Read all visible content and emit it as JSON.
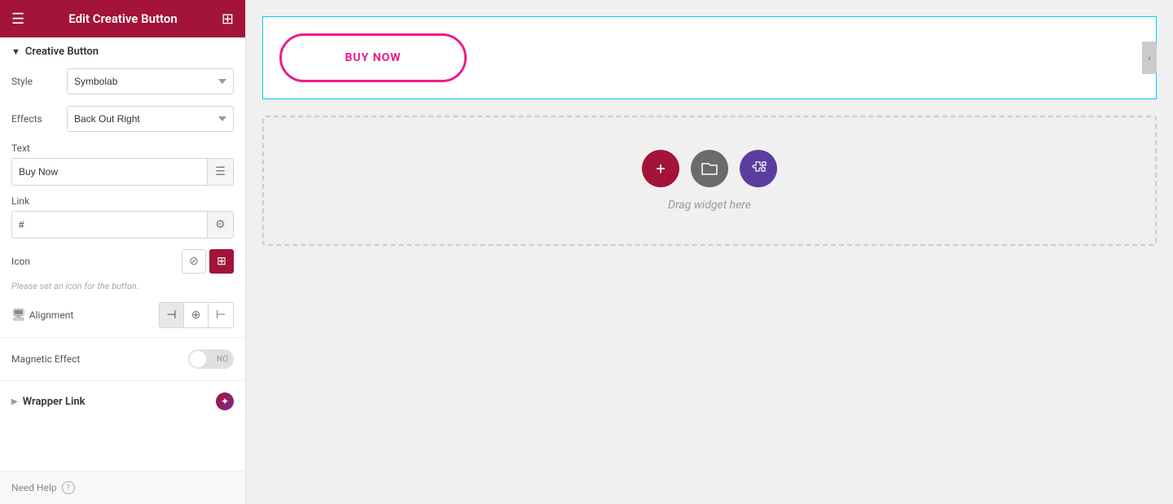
{
  "header": {
    "title": "Edit Creative Button",
    "menu_icon": "☰",
    "grid_icon": "⊞"
  },
  "sidebar": {
    "section_label": "Creative Button",
    "fields": {
      "style_label": "Style",
      "style_value": "Symbolab",
      "effects_label": "Effects",
      "effects_value": "Back Out Right",
      "text_label": "Text",
      "text_value": "Buy Now",
      "text_placeholder": "Buy Now",
      "link_label": "Link",
      "link_value": "#",
      "icon_label": "Icon",
      "icon_hint": "Please set an icon for the button.",
      "alignment_label": "Alignment",
      "magnetic_label": "Magnetic Effect",
      "toggle_no": "NO"
    },
    "wrapper_link": {
      "label": "Wrapper Link"
    },
    "footer": {
      "need_help": "Need Help",
      "help_symbol": "?"
    }
  },
  "canvas": {
    "button_text": "BUY NOW",
    "drop_text": "Drag widget here",
    "collapse_arrow": "‹"
  }
}
